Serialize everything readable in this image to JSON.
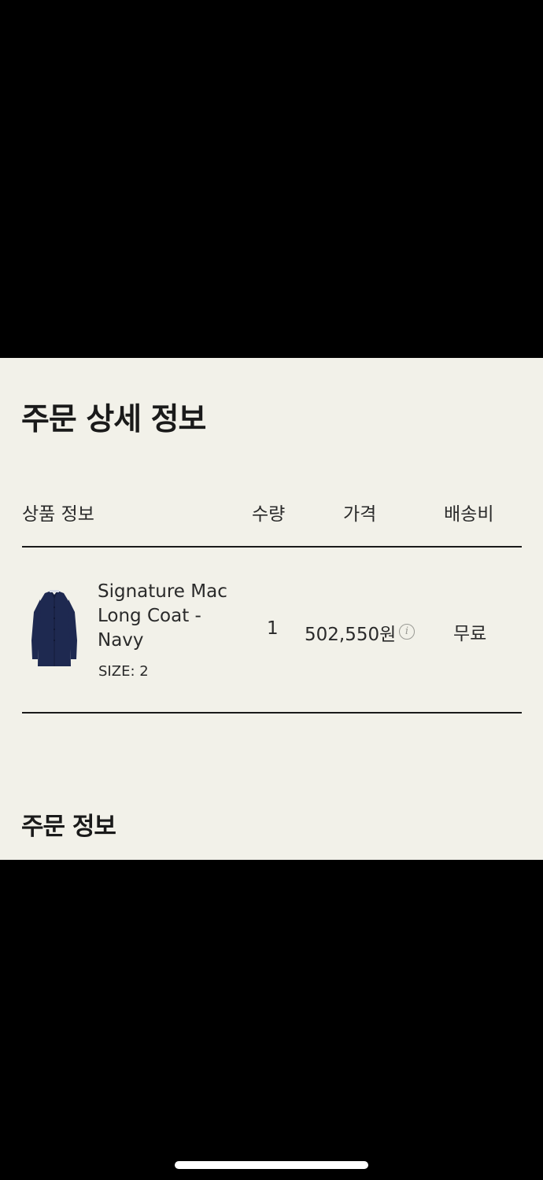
{
  "colors": {
    "panel_background": "#f2f1e9",
    "screen_background": "#000000",
    "text": "#1c1c1c",
    "coat_navy": "#1e2950"
  },
  "order_detail": {
    "title": "주문 상세 정보",
    "columns": {
      "product": "상품 정보",
      "quantity": "수량",
      "price": "가격",
      "shipping": "배송비"
    },
    "item": {
      "name": "Signature Mac Long Coat - Navy",
      "size": "SIZE: 2",
      "quantity": "1",
      "price": "502,550원",
      "price_info_icon": "info-icon",
      "shipping": "무료",
      "thumbnail": "navy-long-coat"
    }
  },
  "order_info": {
    "title": "주문 정보"
  }
}
